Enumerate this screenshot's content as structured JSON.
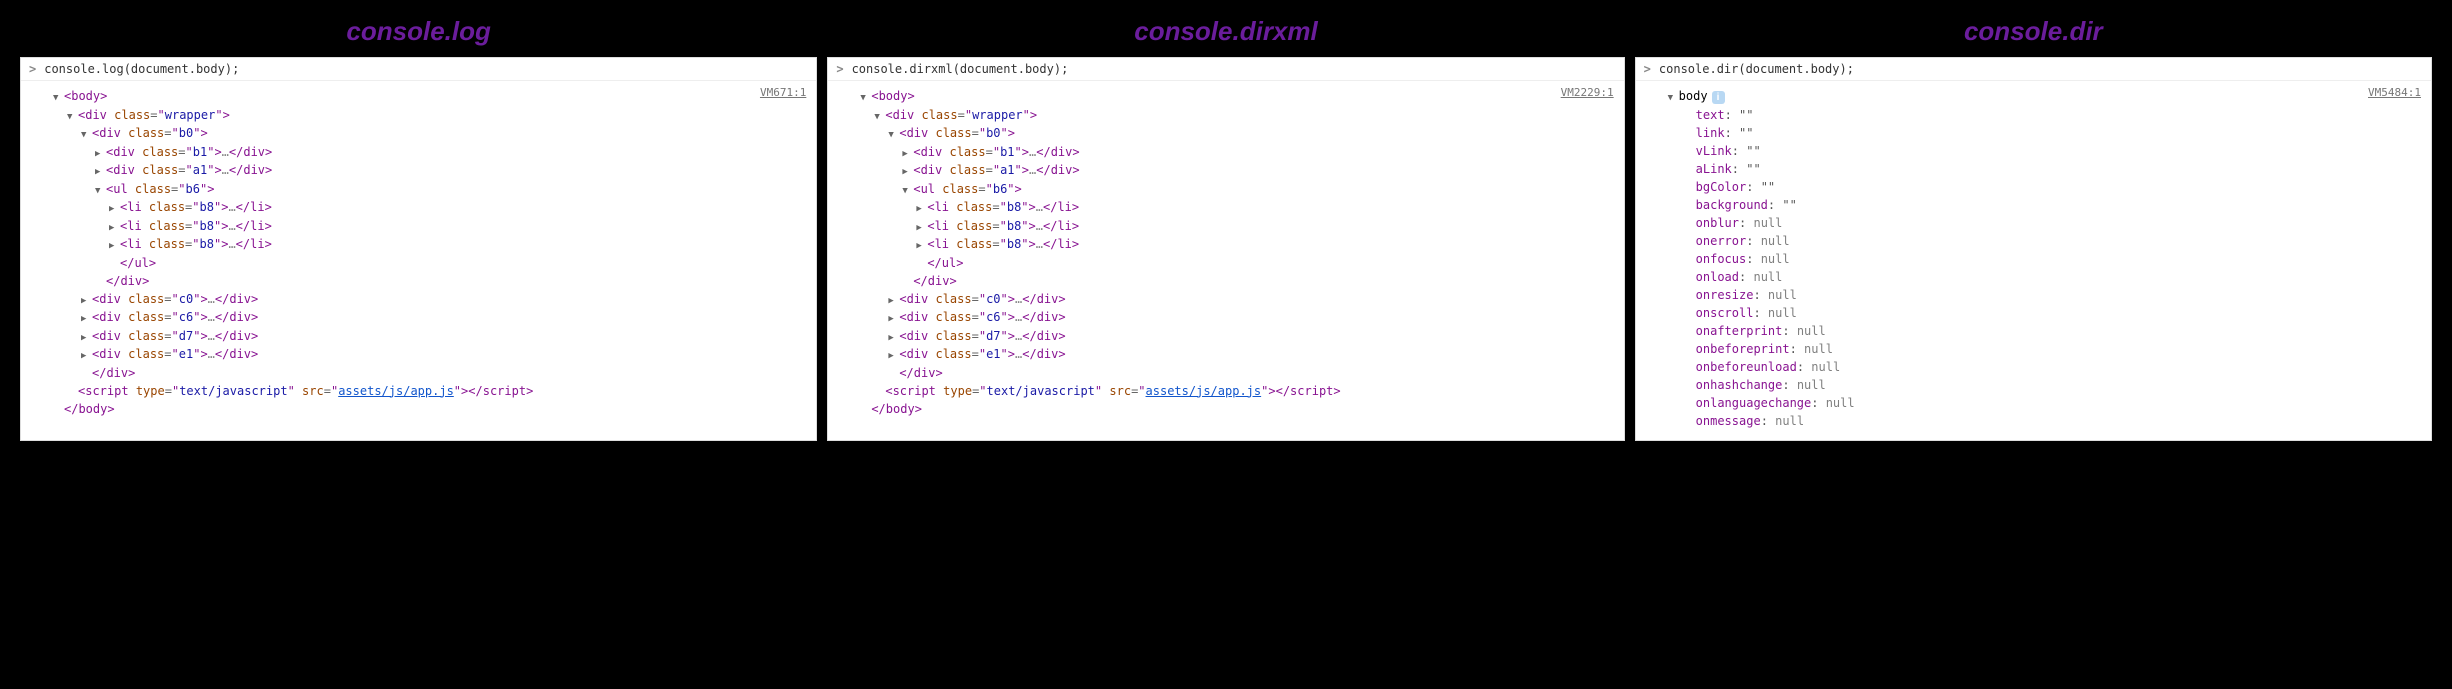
{
  "panels": [
    {
      "title": "console.log",
      "input": "console.log(document.body);",
      "vm": "VM671:1",
      "mode": "dom"
    },
    {
      "title": "console.dirxml",
      "input": "console.dirxml(document.body);",
      "vm": "VM2229:1",
      "mode": "dom"
    },
    {
      "title": "console.dir",
      "input": "console.dir(document.body);",
      "vm": "VM5484:1",
      "mode": "dir"
    }
  ],
  "dom_tree": [
    {
      "indent": 0,
      "disc": "open",
      "kind": "open",
      "tag": "body"
    },
    {
      "indent": 1,
      "disc": "open",
      "kind": "open",
      "tag": "div",
      "attr": "class",
      "val": "wrapper"
    },
    {
      "indent": 2,
      "disc": "open",
      "kind": "open",
      "tag": "div",
      "attr": "class",
      "val": "b0"
    },
    {
      "indent": 3,
      "disc": "closed",
      "kind": "coll",
      "tag": "div",
      "attr": "class",
      "val": "b1"
    },
    {
      "indent": 3,
      "disc": "closed",
      "kind": "coll",
      "tag": "div",
      "attr": "class",
      "val": "a1"
    },
    {
      "indent": 3,
      "disc": "open",
      "kind": "open",
      "tag": "ul",
      "attr": "class",
      "val": "b6"
    },
    {
      "indent": 4,
      "disc": "closed",
      "kind": "coll",
      "tag": "li",
      "attr": "class",
      "val": "b8"
    },
    {
      "indent": 4,
      "disc": "closed",
      "kind": "coll",
      "tag": "li",
      "attr": "class",
      "val": "b8"
    },
    {
      "indent": 4,
      "disc": "closed",
      "kind": "coll",
      "tag": "li",
      "attr": "class",
      "val": "b8"
    },
    {
      "indent": 4,
      "disc": "none",
      "kind": "close",
      "tag": "ul"
    },
    {
      "indent": 3,
      "disc": "none",
      "kind": "close",
      "tag": "div"
    },
    {
      "indent": 2,
      "disc": "closed",
      "kind": "coll",
      "tag": "div",
      "attr": "class",
      "val": "c0"
    },
    {
      "indent": 2,
      "disc": "closed",
      "kind": "coll",
      "tag": "div",
      "attr": "class",
      "val": "c6"
    },
    {
      "indent": 2,
      "disc": "closed",
      "kind": "coll",
      "tag": "div",
      "attr": "class",
      "val": "d7"
    },
    {
      "indent": 2,
      "disc": "closed",
      "kind": "coll",
      "tag": "div",
      "attr": "class",
      "val": "e1"
    },
    {
      "indent": 2,
      "disc": "none",
      "kind": "close",
      "tag": "div"
    },
    {
      "indent": 1,
      "disc": "none",
      "kind": "script",
      "tag": "script",
      "type_val": "text/javascript",
      "src_val": "assets/js/app.js"
    },
    {
      "indent": 0,
      "disc": "none",
      "kind": "close",
      "tag": "body"
    }
  ],
  "dir_header": "body",
  "dir_props": [
    {
      "k": "text",
      "v": "\"\""
    },
    {
      "k": "link",
      "v": "\"\""
    },
    {
      "k": "vLink",
      "v": "\"\""
    },
    {
      "k": "aLink",
      "v": "\"\""
    },
    {
      "k": "bgColor",
      "v": "\"\""
    },
    {
      "k": "background",
      "v": "\"\""
    },
    {
      "k": "onblur",
      "v": "null",
      "n": true
    },
    {
      "k": "onerror",
      "v": "null",
      "n": true
    },
    {
      "k": "onfocus",
      "v": "null",
      "n": true
    },
    {
      "k": "onload",
      "v": "null",
      "n": true
    },
    {
      "k": "onresize",
      "v": "null",
      "n": true
    },
    {
      "k": "onscroll",
      "v": "null",
      "n": true
    },
    {
      "k": "onafterprint",
      "v": "null",
      "n": true
    },
    {
      "k": "onbeforeprint",
      "v": "null",
      "n": true
    },
    {
      "k": "onbeforeunload",
      "v": "null",
      "n": true
    },
    {
      "k": "onhashchange",
      "v": "null",
      "n": true
    },
    {
      "k": "onlanguagechange",
      "v": "null",
      "n": true
    },
    {
      "k": "onmessage",
      "v": "null",
      "n": true
    }
  ]
}
